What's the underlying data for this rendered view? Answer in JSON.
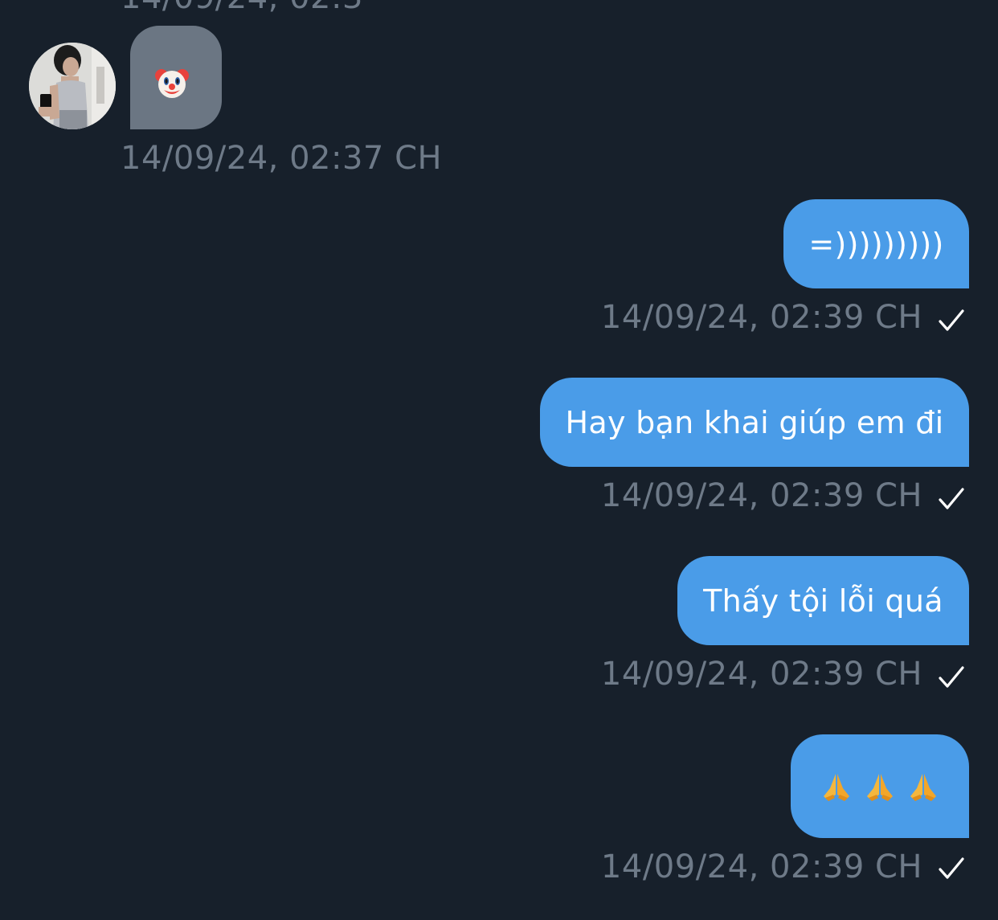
{
  "conversation": {
    "top_partial_timestamp": "14/09/24, 02:3",
    "incoming": {
      "avatar": "avatar",
      "emoji": "clown-face-icon",
      "timestamp": "14/09/24, 02:37 CH"
    },
    "outgoing": [
      {
        "text": "=)))))))))",
        "timestamp": "14/09/24, 02:39 CH",
        "status": "sent-check-icon"
      },
      {
        "text": "Hay bạn khai giúp em đi",
        "timestamp": "14/09/24, 02:39 CH",
        "status": "sent-check-icon"
      },
      {
        "text": "Thấy tội lỗi quá",
        "timestamp": "14/09/24, 02:39 CH",
        "status": "sent-check-icon"
      },
      {
        "emojis": [
          "folded-hands-icon",
          "folded-hands-icon",
          "folded-hands-icon"
        ],
        "timestamp": "14/09/24, 02:39 CH",
        "status": "sent-check-icon"
      }
    ]
  },
  "colors": {
    "background": "#17202b",
    "incoming_bubble": "#6b7683",
    "outgoing_bubble": "#4a9ce8",
    "timestamp_text": "#6e7a88"
  }
}
